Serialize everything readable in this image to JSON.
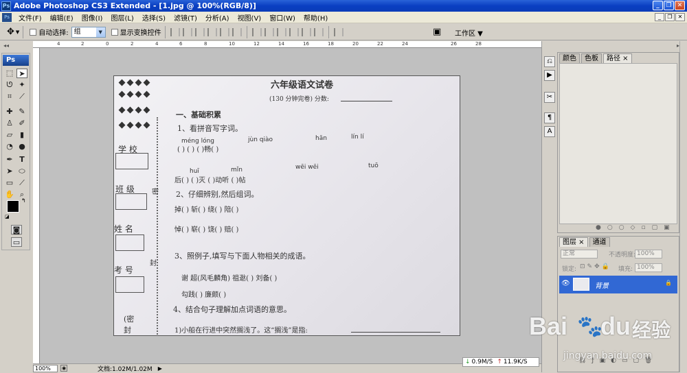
{
  "window": {
    "title": "Adobe Photoshop CS3 Extended - [1.jpg @ 100%(RGB/8)]",
    "logo_text": "Ps"
  },
  "menu": [
    "文件(F)",
    "编辑(E)",
    "图像(I)",
    "图层(L)",
    "选择(S)",
    "滤镜(T)",
    "分析(A)",
    "视图(V)",
    "窗口(W)",
    "帮助(H)"
  ],
  "options": {
    "auto_select_label": "自动选择:",
    "auto_select_value": "组",
    "show_transform_label": "显示变换控件",
    "workspace_label": "工作区"
  },
  "ruler_ticks": [
    "4",
    "2",
    "0",
    "2",
    "4",
    "6",
    "8",
    "10",
    "12",
    "14",
    "16",
    "18",
    "20",
    "22",
    "24",
    "26",
    "28"
  ],
  "toolbox": {
    "logo_text": "Ps"
  },
  "document": {
    "exam_title": "六年级语文试卷",
    "subtitle": "(130 分钟完卷)  分数:",
    "section1": "一、基础积累",
    "q1": "1、看拼音写字词。",
    "pinyin_row1": [
      "méng lóng",
      "jùn qiào",
      "hān",
      "lín lí"
    ],
    "blank_row1": "(         )  (         )  (    )畅(         )",
    "pinyin_row2": [
      "huī",
      "mǐn",
      "wēi wēi",
      "tuō"
    ],
    "blank_row2": "后(    )  (    )灭  (    )动听  (    )帖",
    "q2": "2、仔细辨别,然后组词。",
    "row_q2_1": "掉(      )   斩(      )   绕(      )   陪(      )",
    "row_q2_2": "悼(      )   崭(      )   饶(      )   赔(      )",
    "q3": "3、照例子,填写与下面人物相关的成语。",
    "row_q3_1": "谢  超(风毛麟角)    祖逖(          )    刘备(        )",
    "row_q3_2": "勾践(          )    廉颇(          )",
    "q4": "4、结合句子理解加点词语的意思。",
    "q4_1": "1)小船在行进中突然搁浅了。这“搁浅”是指:",
    "left_labels": [
      "学  校",
      "班  级",
      "姓  名",
      "考  号",
      "(密",
      "封"
    ],
    "seal_labels": [
      "密",
      "封"
    ]
  },
  "status": {
    "zoom": "100%",
    "doc_size": "文档:1.02M/1.02M"
  },
  "net": {
    "down": "0.9M/S",
    "up": "11.9K/S"
  },
  "panel1": {
    "tabs": [
      "颜色",
      "色板",
      "路径"
    ]
  },
  "panel2": {
    "tabs": [
      "图层",
      "通道"
    ],
    "blend_mode": "正常",
    "opacity_label": "不透明度:",
    "opacity_value": "100%",
    "lock_label": "锁定:",
    "fill_label": "填充:",
    "fill_value": "100%",
    "layer_name": "背景"
  },
  "watermark": {
    "brand": "Bai",
    "brand2": "du",
    "cn": "经验",
    "url": "jingyan.baidu.com"
  },
  "colors": {
    "titlebar": "#0a3fc2",
    "layer_selected": "#3168d4",
    "canvas_bg": "#c0c0c0"
  }
}
